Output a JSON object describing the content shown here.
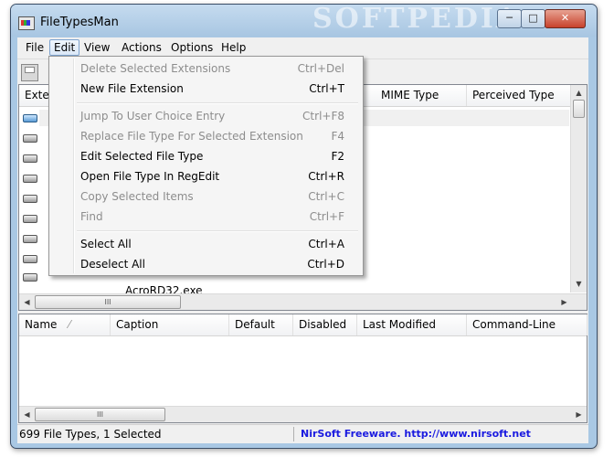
{
  "window": {
    "title": "FileTypesMan",
    "watermark": "SOFTPEDIA"
  },
  "menubar": [
    {
      "label": "File"
    },
    {
      "label": "Edit"
    },
    {
      "label": "View"
    },
    {
      "label": "Actions"
    },
    {
      "label": "Options"
    },
    {
      "label": "Help"
    }
  ],
  "edit_menu": [
    {
      "label": "Delete Selected Extensions",
      "shortcut": "Ctrl+Del",
      "enabled": false
    },
    {
      "label": "New File Extension",
      "shortcut": "Ctrl+T",
      "enabled": true
    },
    {
      "label": "Jump To User Choice Entry",
      "shortcut": "Ctrl+F8",
      "enabled": false
    },
    {
      "label": "Replace File Type For Selected Extension",
      "shortcut": "F4",
      "enabled": false
    },
    {
      "label": "Edit Selected File Type",
      "shortcut": "F2",
      "enabled": true
    },
    {
      "label": "Open File Type In RegEdit",
      "shortcut": "Ctrl+R",
      "enabled": true
    },
    {
      "label": "Copy Selected Items",
      "shortcut": "Ctrl+C",
      "enabled": false
    },
    {
      "label": "Find",
      "shortcut": "Ctrl+F",
      "enabled": false
    },
    {
      "label": "Select All",
      "shortcut": "Ctrl+A",
      "enabled": true
    },
    {
      "label": "Deselect All",
      "shortcut": "Ctrl+D",
      "enabled": true
    }
  ],
  "top_table": {
    "columns": [
      "Exter",
      "MIME Type",
      "Perceived Type"
    ],
    "partial_row_text": "AcroRD32.exe",
    "scroll_grip": "III"
  },
  "bottom_table": {
    "columns": [
      "Name",
      "Caption",
      "Default",
      "Disabled",
      "Last Modified",
      "Command-Line"
    ],
    "scroll_grip": "III"
  },
  "status": {
    "summary": "699 File Types, 1 Selected",
    "link": "NirSoft Freeware.  http://www.nirsoft.net"
  },
  "colors": {
    "link": "#1a1ae0",
    "disabled_text": "#8d8d8d"
  }
}
